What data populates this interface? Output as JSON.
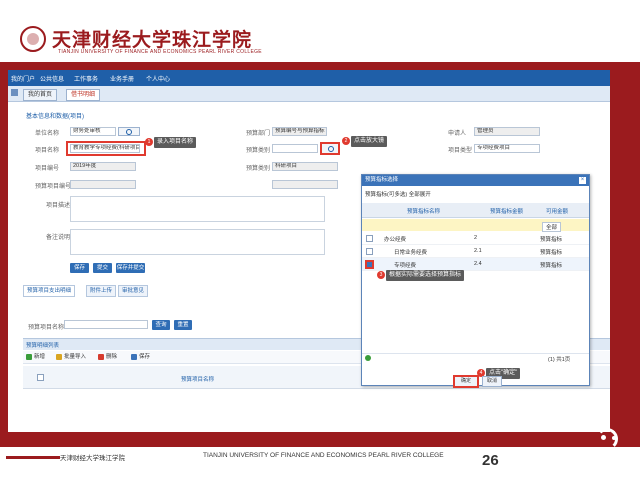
{
  "header": {
    "logo_name": "天津财经大学珠江学院",
    "logo_sub": "TIANJIN UNIVERSITY OF FINANCE AND ECONOMICS PEARL RIVER COLLEGE"
  },
  "nav": {
    "items": [
      "我的门户",
      "公共信息",
      "工作事务",
      "业务手册",
      "个人中心"
    ]
  },
  "tabs": [
    "我的首页",
    "借书明细"
  ],
  "form": {
    "title": "基本信息和数据(项目)",
    "fields": [
      {
        "label": "单位名称",
        "value": "财务处审核"
      },
      {
        "label": "项目名称",
        "value": "教育教学专项经费(科研项目)"
      },
      {
        "label": "项目编号",
        "value": "2019年度"
      },
      {
        "label": "预算类别",
        "value": "科研项目"
      },
      {
        "label": "预算项目编号",
        "value": ""
      },
      {
        "label": "预算部门",
        "value": "预算编号与预算指标"
      },
      {
        "label": "申请人",
        "value": "管理员"
      },
      {
        "label": "项目类型",
        "value": "专项经费项目"
      },
      {
        "label": "项目描述",
        "value": ""
      },
      {
        "label": "备注说明",
        "value": ""
      }
    ],
    "buttons": [
      "保存",
      "提交",
      "保存并提交"
    ],
    "subtabs": [
      "预算项目支出明细",
      "附件上传",
      "审批意见"
    ],
    "search_label": "预算项目名称",
    "search_buttons": [
      "查询",
      "重置"
    ],
    "section_title": "预算明细列表",
    "toolbar": [
      {
        "label": "新增",
        "color": "#3a9d3a"
      },
      {
        "label": "批量导入",
        "color": "#d9a521"
      },
      {
        "label": "删除",
        "color": "#d63b2e"
      },
      {
        "label": "保存",
        "color": "#3b73b9"
      }
    ],
    "table_header": "预算项目名称"
  },
  "callouts": [
    {
      "num": "1",
      "text": "录入项目名称"
    },
    {
      "num": "2",
      "text": "点击放大镜"
    },
    {
      "num": "3",
      "text": "根据实际需要选择预算指标"
    },
    {
      "num": "4",
      "text": "点击\"确定\""
    }
  ],
  "dialog": {
    "title": "预算指标选择",
    "subtitle": "预算指标(可多选)  全部展开",
    "columns": [
      "预算指标名称",
      "预算指标金额",
      "可用金额"
    ],
    "filter": "全部",
    "rows": [
      {
        "name": "办公经费",
        "amount": "2",
        "avail": "预算指标"
      },
      {
        "name": "日常业务经费",
        "amount": "2.1",
        "avail": "预算指标"
      },
      {
        "name": "专项经费",
        "amount": "2.4",
        "avail": "预算指标"
      }
    ],
    "pager": "(1) 共1页",
    "ok": "确定",
    "cancel": "取消"
  },
  "footer": {
    "left": "天津财经大学珠江学院",
    "mid": "TIANJIN UNIVERSITY OF FINANCE AND ECONOMICS PEARL RIVER COLLEGE",
    "page": "26"
  },
  "colors": {
    "brand": "#9b1b1e",
    "nav": "#1f5fa8",
    "marker": "#e03a2f"
  }
}
